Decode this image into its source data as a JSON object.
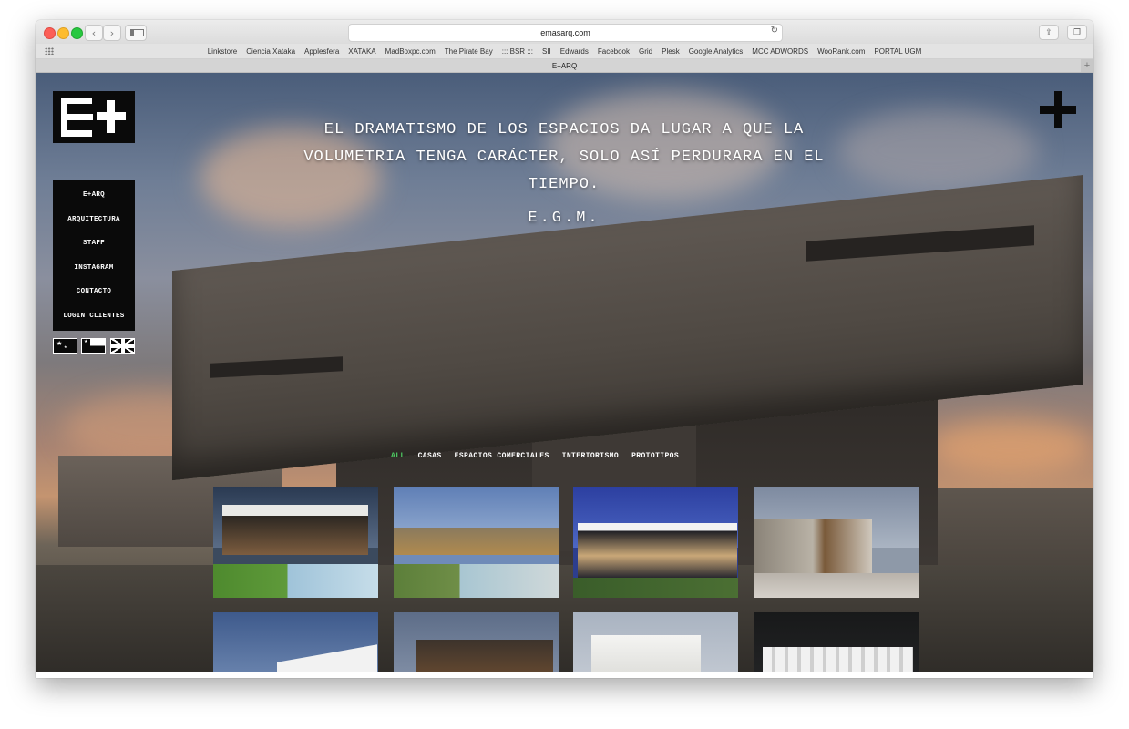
{
  "browser": {
    "url": "emasarq.com",
    "tab_title": "E+ARQ",
    "bookmarks": [
      "Linkstore",
      "Ciencia Xataka",
      "Applesfera",
      "XATAKA",
      "MadBoxpc.com",
      "The Pirate Bay",
      "::: BSR :::",
      "SII",
      "Edwards",
      "Facebook",
      "Grid",
      "Plesk",
      "Google Analytics",
      "MCC ADWORDS",
      "WooRank.com",
      "PORTAL UGM"
    ]
  },
  "site": {
    "menu": [
      "E+ARQ",
      "ARQUITECTURA",
      "STAFF",
      "INSTAGRAM",
      "CONTACTO",
      "LOGIN CLIENTES"
    ],
    "languages": [
      "china-flag-icon",
      "chile-flag-icon",
      "uk-flag-icon"
    ],
    "quote": "EL DRAMATISMO DE LOS ESPACIOS DA LUGAR A QUE LA VOLUMETRIA TENGA CARÁCTER, SOLO ASÍ PERDURARA EN EL TIEMPO.",
    "quote_author": "E.G.M.",
    "filters": [
      "ALL",
      "CASAS",
      "ESPACIOS COMERCIALES",
      "INTERIORISMO",
      "PROTOTIPOS"
    ],
    "active_filter": "ALL",
    "accent_color": "#4fcf64"
  }
}
